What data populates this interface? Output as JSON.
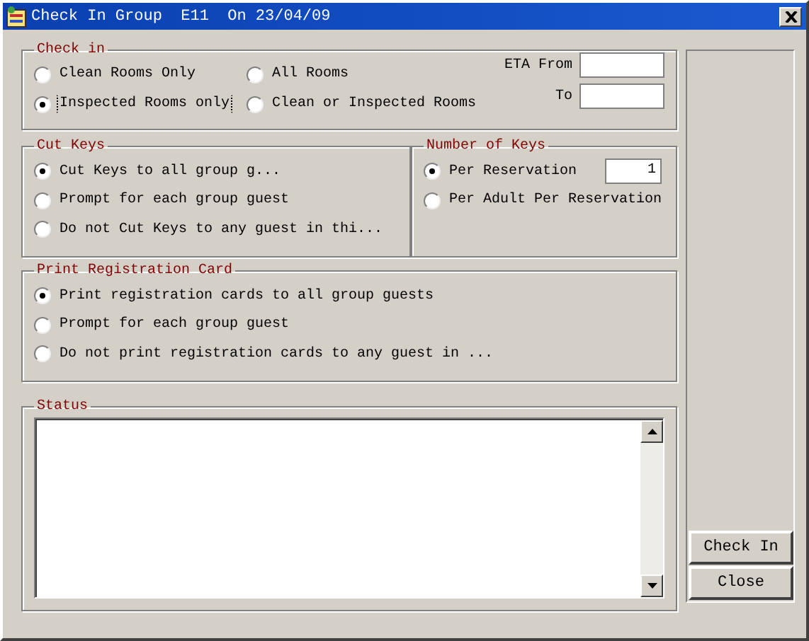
{
  "window": {
    "title": "Check In Group  E11  On 23/04/09"
  },
  "check_in": {
    "title": "Check in",
    "options": [
      {
        "label": "Clean Rooms Only",
        "selected": false,
        "focused": false
      },
      {
        "label": "All Rooms",
        "selected": false,
        "focused": false
      },
      {
        "label": "Inspected Rooms only",
        "selected": true,
        "focused": true
      },
      {
        "label": "Clean or Inspected Rooms",
        "selected": false,
        "focused": false
      }
    ],
    "eta_from": {
      "label": "ETA From"
    },
    "to": {
      "label": "To"
    }
  },
  "cut_keys": {
    "title": "Cut Keys",
    "options": [
      {
        "label": "Cut Keys to all group g...",
        "selected": true
      },
      {
        "label": "Prompt for each group guest",
        "selected": false
      },
      {
        "label": "Do not Cut Keys to any guest in thi...",
        "selected": false
      }
    ]
  },
  "number_of_keys": {
    "title": "Number of Keys",
    "options": [
      {
        "label": "Per Reservation",
        "selected": true,
        "value": "1"
      },
      {
        "label": "Per Adult Per Reservation",
        "selected": false
      }
    ]
  },
  "print_registration_card": {
    "title": "Print Registration Card",
    "options": [
      {
        "label": "Print registration cards to all group guests",
        "selected": true
      },
      {
        "label": "Prompt for each group guest",
        "selected": false
      },
      {
        "label": "Do not print registration cards to any guest in ...",
        "selected": false
      }
    ]
  },
  "status": {
    "title": "Status"
  },
  "buttons": [
    "Check In",
    "Close"
  ]
}
